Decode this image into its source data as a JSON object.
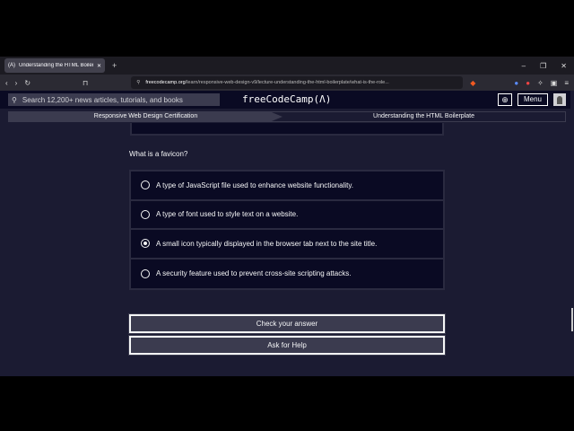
{
  "browser": {
    "tab_title": "Understanding the HTML Boilerp",
    "url_domain": "freecodecamp.org",
    "url_path": "/learn/responsive-web-design-v9/lecture-understanding-the-html-boilerplate/what-is-the-role..."
  },
  "nav": {
    "search_placeholder": "Search 12,200+ news articles, tutorials, and books",
    "logo": "freeCodeCamp(Λ)",
    "menu": "Menu"
  },
  "breadcrumb": {
    "cert": "Responsive Web Design Certification",
    "lesson": "Understanding the HTML Boilerplate"
  },
  "quiz": {
    "question": "What is a favicon?",
    "options": [
      {
        "label": "A type of JavaScript file used to enhance website functionality.",
        "selected": false
      },
      {
        "label": "A type of font used to style text on a website.",
        "selected": false
      },
      {
        "label": "A small icon typically displayed in the browser tab next to the site title.",
        "selected": true
      },
      {
        "label": "A security feature used to prevent cross-site scripting attacks.",
        "selected": false
      }
    ]
  },
  "buttons": {
    "check": "Check your answer",
    "help": "Ask for Help"
  }
}
